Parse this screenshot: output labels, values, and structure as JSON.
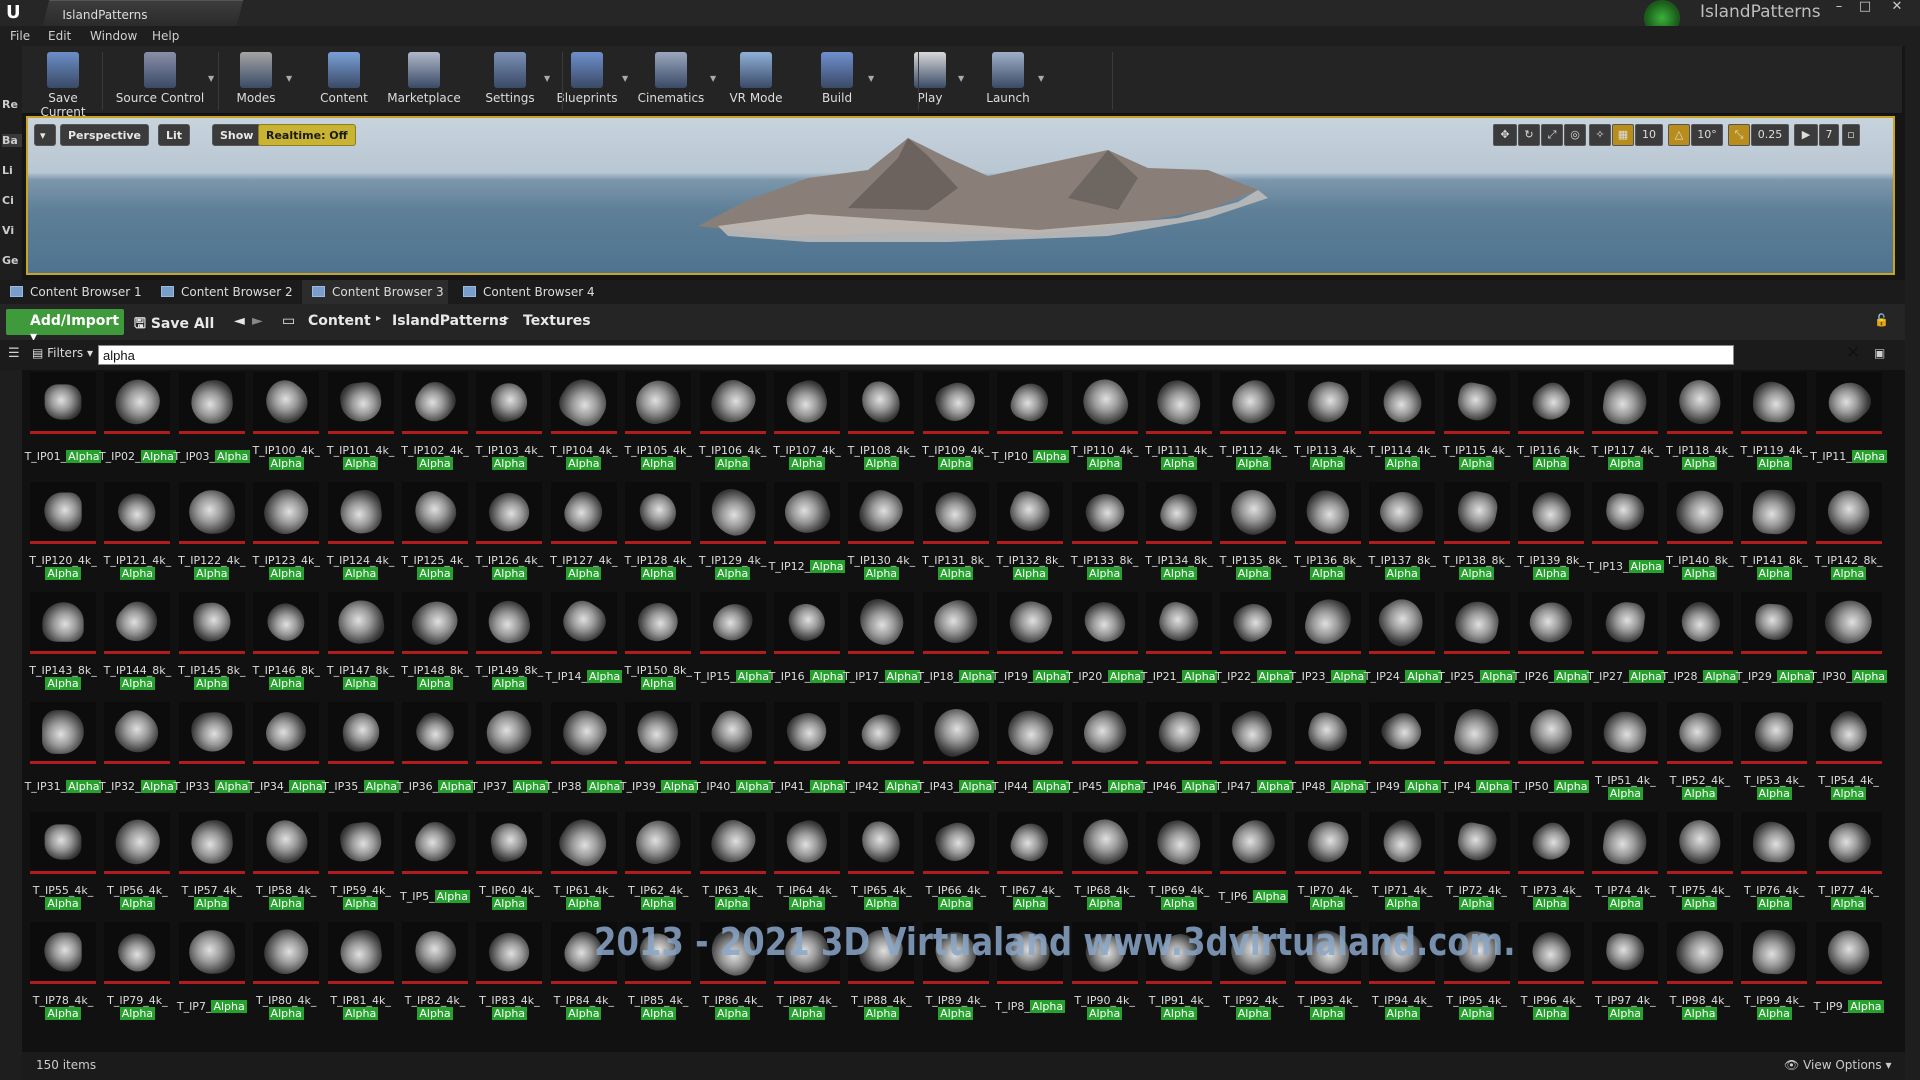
{
  "window": {
    "tab_title": "IslandPatterns",
    "project_name": "IslandPatterns"
  },
  "menu": [
    "File",
    "Edit",
    "Window",
    "Help"
  ],
  "toolbar": [
    {
      "label": "Save Current",
      "icon": "save-icon"
    },
    {
      "label": "Source Control",
      "icon": "source-control-icon"
    },
    {
      "label": "Modes",
      "icon": "modes-icon"
    },
    {
      "label": "Content",
      "icon": "content-icon"
    },
    {
      "label": "Marketplace",
      "icon": "marketplace-icon"
    },
    {
      "label": "Settings",
      "icon": "settings-icon"
    },
    {
      "label": "Blueprints",
      "icon": "blueprints-icon"
    },
    {
      "label": "Cinematics",
      "icon": "cinematics-icon"
    },
    {
      "label": "VR Mode",
      "icon": "vr-icon"
    },
    {
      "label": "Build",
      "icon": "build-icon"
    },
    {
      "label": "Play",
      "icon": "play-icon"
    },
    {
      "label": "Launch",
      "icon": "launch-icon"
    }
  ],
  "left_strip": [
    "Re",
    "Ba",
    "Li",
    "Ci",
    "Vi",
    "Ge"
  ],
  "viewport": {
    "perspective": "Perspective",
    "lit": "Lit",
    "show": "Show",
    "realtime": "Realtime: Off",
    "grid_snap": "10",
    "rot_snap": "10°",
    "scale_snap": "0.25",
    "cam_speed": "7"
  },
  "cb_tabs": [
    "Content Browser 1",
    "Content Browser 2",
    "Content Browser 3",
    "Content Browser 4"
  ],
  "cb_active_tab": 2,
  "cb": {
    "add_import": "Add/Import",
    "save_all": "Save All",
    "path": [
      "Content",
      "IslandPatterns",
      "Textures"
    ]
  },
  "search": {
    "filters_label": "Filters",
    "value": "alpha"
  },
  "assets": [
    [
      "T_IP01_",
      "Alpha"
    ],
    [
      "T_IP02_",
      "Alpha"
    ],
    [
      "T_IP03_",
      "Alpha"
    ],
    [
      "T_IP100_4k_",
      "Alpha"
    ],
    [
      "T_IP101_4k_",
      "Alpha"
    ],
    [
      "T_IP102_4k_",
      "Alpha"
    ],
    [
      "T_IP103_4k_",
      "Alpha"
    ],
    [
      "T_IP104_4k_",
      "Alpha"
    ],
    [
      "T_IP105_4k_",
      "Alpha"
    ],
    [
      "T_IP106_4k_",
      "Alpha"
    ],
    [
      "T_IP107_4k_",
      "Alpha"
    ],
    [
      "T_IP108_4k_",
      "Alpha"
    ],
    [
      "T_IP109_4k_",
      "Alpha"
    ],
    [
      "T_IP10_",
      "Alpha"
    ],
    [
      "T_IP110_4k_",
      "Alpha"
    ],
    [
      "T_IP111_4k_",
      "Alpha"
    ],
    [
      "T_IP112_4k_",
      "Alpha"
    ],
    [
      "T_IP113_4k_",
      "Alpha"
    ],
    [
      "T_IP114_4k_",
      "Alpha"
    ],
    [
      "T_IP115_4k_",
      "Alpha"
    ],
    [
      "T_IP116_4k_",
      "Alpha"
    ],
    [
      "T_IP117_4k_",
      "Alpha"
    ],
    [
      "T_IP118_4k_",
      "Alpha"
    ],
    [
      "T_IP119_4k_",
      "Alpha"
    ],
    [
      "T_IP11_",
      "Alpha"
    ],
    [
      "T_IP120_4k_",
      "Alpha"
    ],
    [
      "T_IP121_4k_",
      "Alpha"
    ],
    [
      "T_IP122_4k_",
      "Alpha"
    ],
    [
      "T_IP123_4k_",
      "Alpha"
    ],
    [
      "T_IP124_4k_",
      "Alpha"
    ],
    [
      "T_IP125_4k_",
      "Alpha"
    ],
    [
      "T_IP126_4k_",
      "Alpha"
    ],
    [
      "T_IP127_4k_",
      "Alpha"
    ],
    [
      "T_IP128_4k_",
      "Alpha"
    ],
    [
      "T_IP129_4k_",
      "Alpha"
    ],
    [
      "T_IP12_",
      "Alpha"
    ],
    [
      "T_IP130_4k_",
      "Alpha"
    ],
    [
      "T_IP131_8k_",
      "Alpha"
    ],
    [
      "T_IP132_8k_",
      "Alpha"
    ],
    [
      "T_IP133_8k_",
      "Alpha"
    ],
    [
      "T_IP134_8k_",
      "Alpha"
    ],
    [
      "T_IP135_8k_",
      "Alpha"
    ],
    [
      "T_IP136_8k_",
      "Alpha"
    ],
    [
      "T_IP137_8k_",
      "Alpha"
    ],
    [
      "T_IP138_8k_",
      "Alpha"
    ],
    [
      "T_IP139_8k_",
      "Alpha"
    ],
    [
      "T_IP13_",
      "Alpha"
    ],
    [
      "T_IP140_8k_",
      "Alpha"
    ],
    [
      "T_IP141_8k_",
      "Alpha"
    ],
    [
      "T_IP142_8k_",
      "Alpha"
    ],
    [
      "T_IP143_8k_",
      "Alpha"
    ],
    [
      "T_IP144_8k_",
      "Alpha"
    ],
    [
      "T_IP145_8k_",
      "Alpha"
    ],
    [
      "T_IP146_8k_",
      "Alpha"
    ],
    [
      "T_IP147_8k_",
      "Alpha"
    ],
    [
      "T_IP148_8k_",
      "Alpha"
    ],
    [
      "T_IP149_8k_",
      "Alpha"
    ],
    [
      "T_IP14_",
      "Alpha"
    ],
    [
      "T_IP150_8k_",
      "Alpha"
    ],
    [
      "T_IP15_",
      "Alpha"
    ],
    [
      "T_IP16_",
      "Alpha"
    ],
    [
      "T_IP17_",
      "Alpha"
    ],
    [
      "T_IP18_",
      "Alpha"
    ],
    [
      "T_IP19_",
      "Alpha"
    ],
    [
      "T_IP20_",
      "Alpha"
    ],
    [
      "T_IP21_",
      "Alpha"
    ],
    [
      "T_IP22_",
      "Alpha"
    ],
    [
      "T_IP23_",
      "Alpha"
    ],
    [
      "T_IP24_",
      "Alpha"
    ],
    [
      "T_IP25_",
      "Alpha"
    ],
    [
      "T_IP26_",
      "Alpha"
    ],
    [
      "T_IP27_",
      "Alpha"
    ],
    [
      "T_IP28_",
      "Alpha"
    ],
    [
      "T_IP29_",
      "Alpha"
    ],
    [
      "T_IP30_",
      "Alpha"
    ],
    [
      "T_IP31_",
      "Alpha"
    ],
    [
      "T_IP32_",
      "Alpha"
    ],
    [
      "T_IP33_",
      "Alpha"
    ],
    [
      "T_IP34_",
      "Alpha"
    ],
    [
      "T_IP35_",
      "Alpha"
    ],
    [
      "T_IP36_",
      "Alpha"
    ],
    [
      "T_IP37_",
      "Alpha"
    ],
    [
      "T_IP38_",
      "Alpha"
    ],
    [
      "T_IP39_",
      "Alpha"
    ],
    [
      "T_IP40_",
      "Alpha"
    ],
    [
      "T_IP41_",
      "Alpha"
    ],
    [
      "T_IP42_",
      "Alpha"
    ],
    [
      "T_IP43_",
      "Alpha"
    ],
    [
      "T_IP44_",
      "Alpha"
    ],
    [
      "T_IP45_",
      "Alpha"
    ],
    [
      "T_IP46_",
      "Alpha"
    ],
    [
      "T_IP47_",
      "Alpha"
    ],
    [
      "T_IP48_",
      "Alpha"
    ],
    [
      "T_IP49_",
      "Alpha"
    ],
    [
      "T_IP4_",
      "Alpha"
    ],
    [
      "T_IP50_",
      "Alpha"
    ],
    [
      "T_IP51_4k_",
      "Alpha"
    ],
    [
      "T_IP52_4k_",
      "Alpha"
    ],
    [
      "T_IP53_4k_",
      "Alpha"
    ],
    [
      "T_IP54_4k_",
      "Alpha"
    ],
    [
      "T_IP55_4k_",
      "Alpha"
    ],
    [
      "T_IP56_4k_",
      "Alpha"
    ],
    [
      "T_IP57_4k_",
      "Alpha"
    ],
    [
      "T_IP58_4k_",
      "Alpha"
    ],
    [
      "T_IP59_4k_",
      "Alpha"
    ],
    [
      "T_IP5_",
      "Alpha"
    ],
    [
      "T_IP60_4k_",
      "Alpha"
    ],
    [
      "T_IP61_4k_",
      "Alpha"
    ],
    [
      "T_IP62_4k_",
      "Alpha"
    ],
    [
      "T_IP63_4k_",
      "Alpha"
    ],
    [
      "T_IP64_4k_",
      "Alpha"
    ],
    [
      "T_IP65_4k_",
      "Alpha"
    ],
    [
      "T_IP66_4k_",
      "Alpha"
    ],
    [
      "T_IP67_4k_",
      "Alpha"
    ],
    [
      "T_IP68_4k_",
      "Alpha"
    ],
    [
      "T_IP69_4k_",
      "Alpha"
    ],
    [
      "T_IP6_",
      "Alpha"
    ],
    [
      "T_IP70_4k_",
      "Alpha"
    ],
    [
      "T_IP71_4k_",
      "Alpha"
    ],
    [
      "T_IP72_4k_",
      "Alpha"
    ],
    [
      "T_IP73_4k_",
      "Alpha"
    ],
    [
      "T_IP74_4k_",
      "Alpha"
    ],
    [
      "T_IP75_4k_",
      "Alpha"
    ],
    [
      "T_IP76_4k_",
      "Alpha"
    ],
    [
      "T_IP77_4k_",
      "Alpha"
    ],
    [
      "T_IP78_4k_",
      "Alpha"
    ],
    [
      "T_IP79_4k_",
      "Alpha"
    ],
    [
      "T_IP7_",
      "Alpha"
    ],
    [
      "T_IP80_4k_",
      "Alpha"
    ],
    [
      "T_IP81_4k_",
      "Alpha"
    ],
    [
      "T_IP82_4k_",
      "Alpha"
    ],
    [
      "T_IP83_4k_",
      "Alpha"
    ],
    [
      "T_IP84_4k_",
      "Alpha"
    ],
    [
      "T_IP85_4k_",
      "Alpha"
    ],
    [
      "T_IP86_4k_",
      "Alpha"
    ],
    [
      "T_IP87_4k_",
      "Alpha"
    ],
    [
      "T_IP88_4k_",
      "Alpha"
    ],
    [
      "T_IP89_4k_",
      "Alpha"
    ],
    [
      "T_IP8_",
      "Alpha"
    ],
    [
      "T_IP90_4k_",
      "Alpha"
    ],
    [
      "T_IP91_4k_",
      "Alpha"
    ],
    [
      "T_IP92_4k_",
      "Alpha"
    ],
    [
      "T_IP93_4k_",
      "Alpha"
    ],
    [
      "T_IP94_4k_",
      "Alpha"
    ],
    [
      "T_IP95_4k_",
      "Alpha"
    ],
    [
      "T_IP96_4k_",
      "Alpha"
    ],
    [
      "T_IP97_4k_",
      "Alpha"
    ],
    [
      "T_IP98_4k_",
      "Alpha"
    ],
    [
      "T_IP99_4k_",
      "Alpha"
    ],
    [
      "T_IP9_",
      "Alpha"
    ]
  ],
  "status": {
    "item_count": "150 items",
    "view_options": "View Options"
  },
  "watermark": "2013 - 2021 3D Virtualand www.3dvirtualand.com.",
  "colors": {
    "accent_green": "#3e9a3b",
    "highlight_green": "#27a12e",
    "viewport_border": "#c9a323",
    "thumb_underline": "#b31c1c"
  }
}
